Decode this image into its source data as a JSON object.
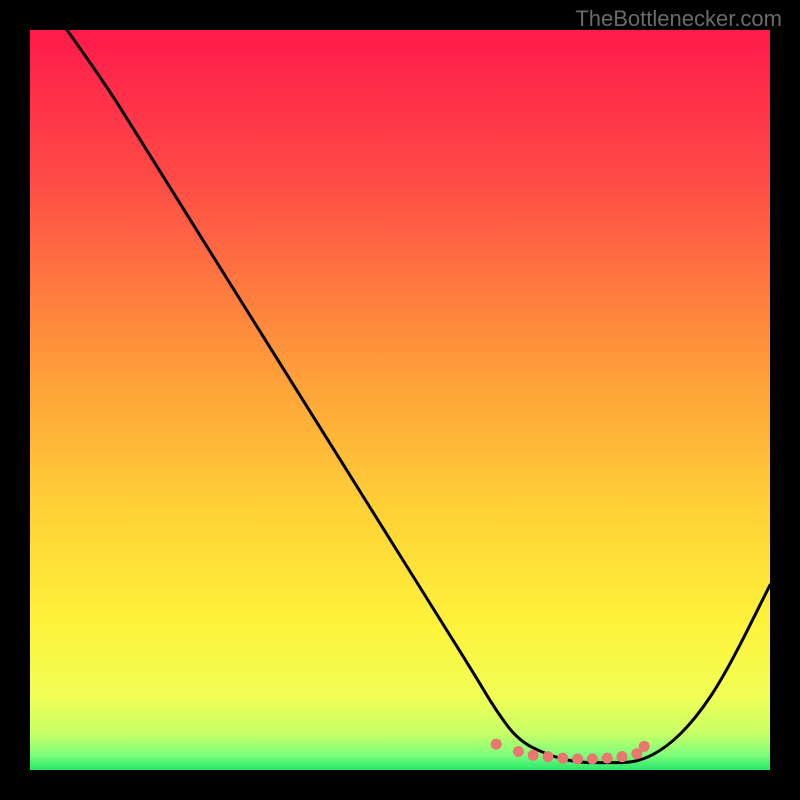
{
  "watermark": "TheBottlenecker.com",
  "chart_data": {
    "type": "line",
    "title": "",
    "xlabel": "",
    "ylabel": "",
    "xlim": [
      0,
      100
    ],
    "ylim": [
      0,
      100
    ],
    "series": [
      {
        "name": "curve",
        "x": [
          5,
          10,
          15,
          20,
          25,
          30,
          35,
          40,
          45,
          50,
          55,
          60,
          63,
          66,
          70,
          74,
          78,
          82,
          86,
          90,
          94,
          100
        ],
        "values": [
          100,
          93,
          85,
          77,
          69,
          61,
          53,
          45,
          37,
          29,
          21,
          13,
          8,
          4,
          2,
          1,
          1,
          1,
          3,
          7,
          13,
          25
        ]
      },
      {
        "name": "dots",
        "x": [
          63,
          66,
          68,
          70,
          72,
          74,
          76,
          78,
          80,
          82,
          83
        ],
        "values": [
          3.5,
          2.5,
          2.0,
          1.8,
          1.6,
          1.5,
          1.5,
          1.6,
          1.8,
          2.2,
          3.2
        ]
      }
    ],
    "gradient_stops": [
      {
        "pct": 0,
        "color": "#ff1a4b"
      },
      {
        "pct": 20,
        "color": "#ff4a46"
      },
      {
        "pct": 45,
        "color": "#ff9a3a"
      },
      {
        "pct": 65,
        "color": "#ffd236"
      },
      {
        "pct": 80,
        "color": "#fff23a"
      },
      {
        "pct": 90,
        "color": "#f1ff55"
      },
      {
        "pct": 95,
        "color": "#c8ff66"
      },
      {
        "pct": 98,
        "color": "#7dff7a"
      },
      {
        "pct": 100,
        "color": "#27e66a"
      }
    ]
  }
}
